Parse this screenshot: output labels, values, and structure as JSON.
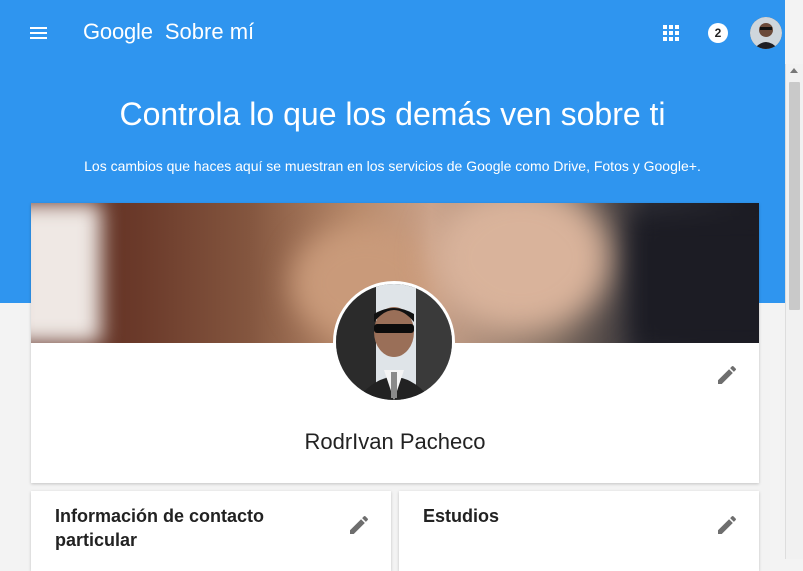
{
  "header": {
    "google_word": "Google",
    "product_name": "Sobre mí",
    "notification_count": "2",
    "menu_icon": "menu-icon",
    "apps_icon": "apps-grid-icon"
  },
  "hero": {
    "title": "Controla lo que los demás ven sobre ti",
    "subtitle": "Los cambios que haces aquí se muestran en los servicios de Google como Drive, Fotos y Google+."
  },
  "profile": {
    "name": "RodrIvan Pacheco",
    "edit_icon": "pencil-icon"
  },
  "sections": [
    {
      "title_line1": "Información de contacto",
      "title_line2": "particular"
    },
    {
      "title_line1": "Estudios"
    }
  ],
  "colors": {
    "brand_blue": "#2f95ef",
    "card_bg": "#ffffff",
    "page_bg": "#f3f3f3"
  }
}
